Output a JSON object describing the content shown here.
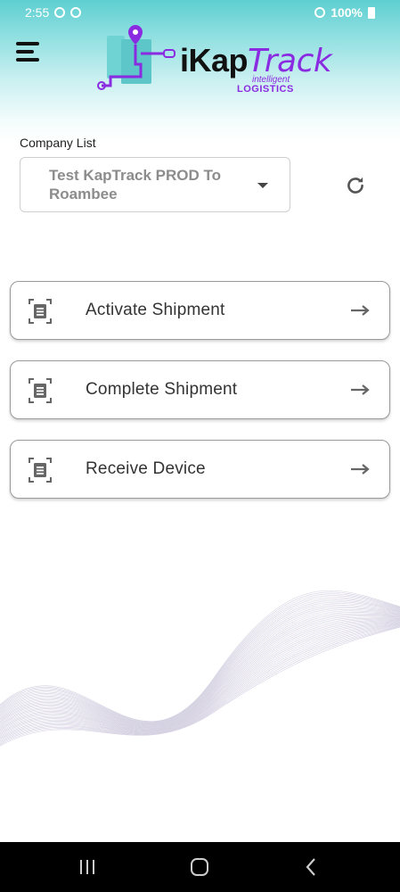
{
  "status_bar": {
    "time": "2:55",
    "battery": "100%"
  },
  "header": {
    "menu_icon": "hamburger-menu-icon",
    "logo": {
      "word_part1": "iKap",
      "word_part2": "Track",
      "tagline": "intelligent",
      "sub": "LOGISTICS"
    }
  },
  "company": {
    "label": "Company List",
    "selected": "Test KapTrack PROD To Roambee",
    "refresh_icon": "refresh-icon"
  },
  "actions": [
    {
      "label": "Activate Shipment",
      "icon": "document-scan-icon"
    },
    {
      "label": "Complete Shipment",
      "icon": "document-scan-icon"
    },
    {
      "label": "Receive Device",
      "icon": "document-scan-icon"
    }
  ],
  "colors": {
    "brand_purple": "#8a2be2",
    "brand_teal": "#5ecfd1",
    "card_border": "#9a9a9a"
  },
  "nav": {
    "recents_icon": "recents-icon",
    "home_icon": "home-icon",
    "back_icon": "back-icon"
  }
}
